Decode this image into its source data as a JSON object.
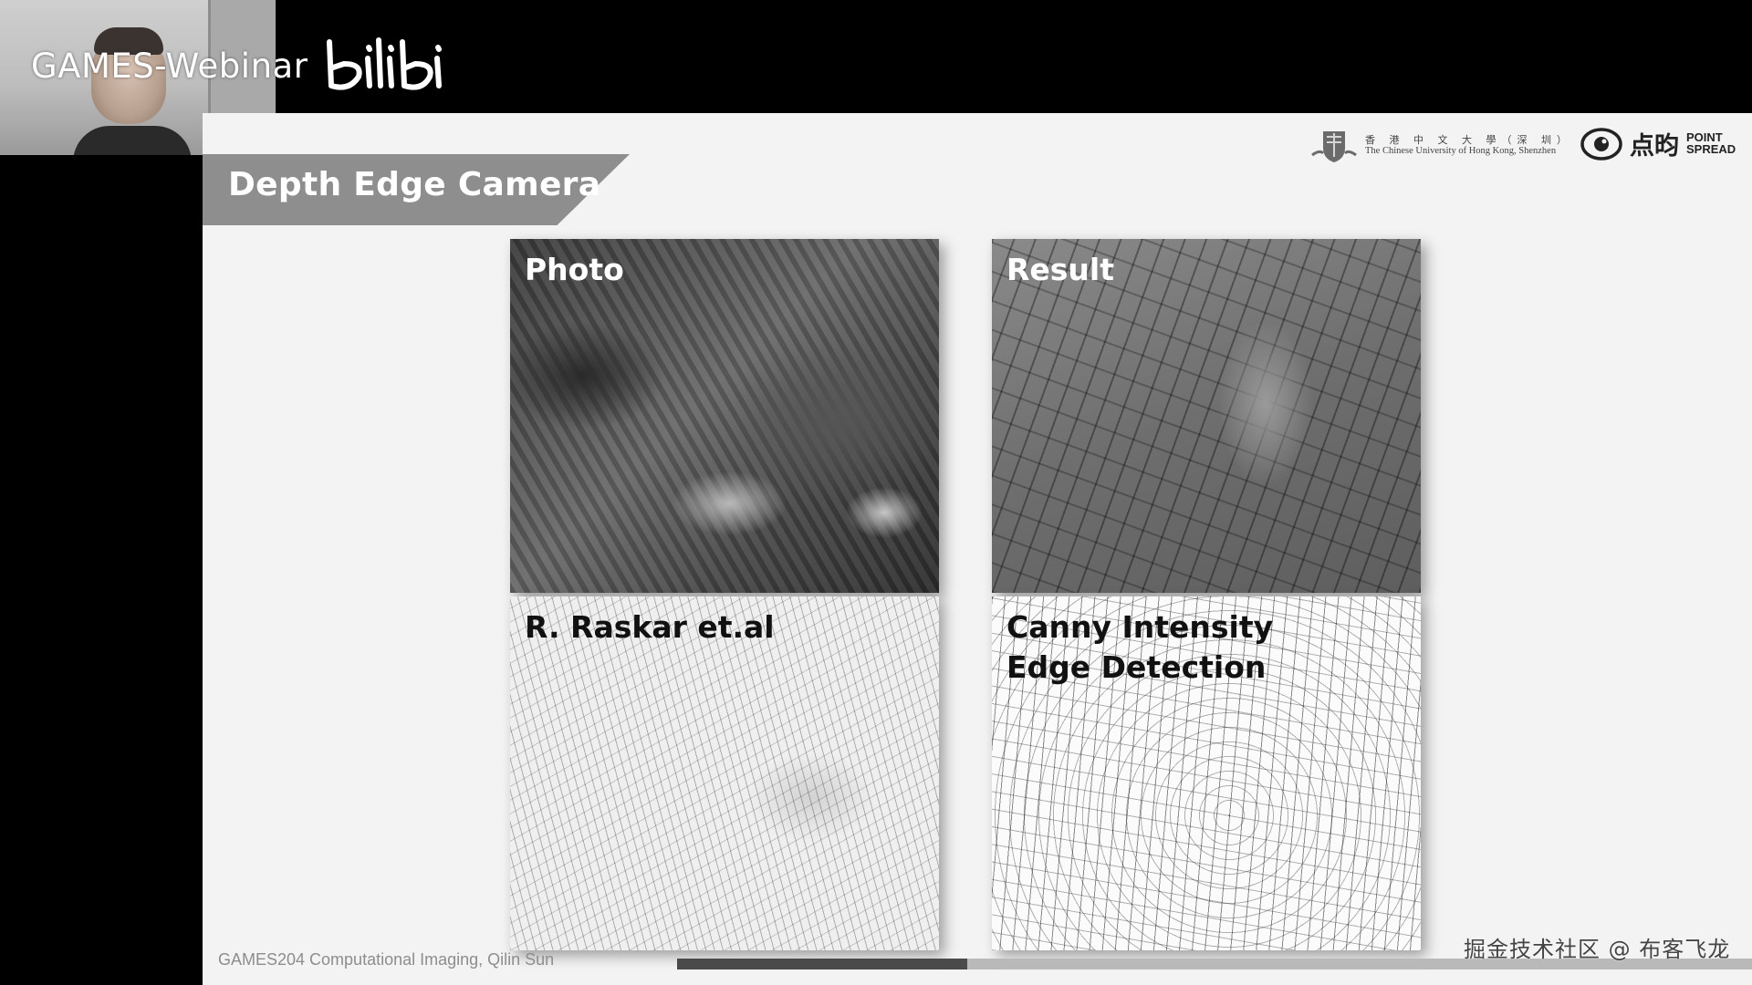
{
  "brand": {
    "text": "GAMES-Webinar",
    "logo": "bilibili"
  },
  "slide": {
    "title": "Depth Edge Camera",
    "logos": {
      "cuhk_cn": "香 港 中 文 大 學（深 圳）",
      "cuhk_en": "The Chinese University of Hong Kong, Shenzhen",
      "pointspread_cn": "点昀",
      "pointspread_en_1": "POINT",
      "pointspread_en_2": "SPREAD"
    },
    "panels": {
      "photo": "Photo",
      "result": "Result",
      "raskar": "R. Raskar et.al",
      "canny_line1": "Canny Intensity",
      "canny_line2": "Edge Detection"
    },
    "footer": "GAMES204 Computational Imaging, Qilin Sun",
    "progress": 0.27
  },
  "watermark": "掘金技术社区 @ 布客飞龙",
  "colors": {
    "slide_bg": "#f3f3f3",
    "title_banner": "#8e8e8e",
    "progress_fill": "#4a4a4a",
    "progress_track": "#b9b9b9"
  }
}
